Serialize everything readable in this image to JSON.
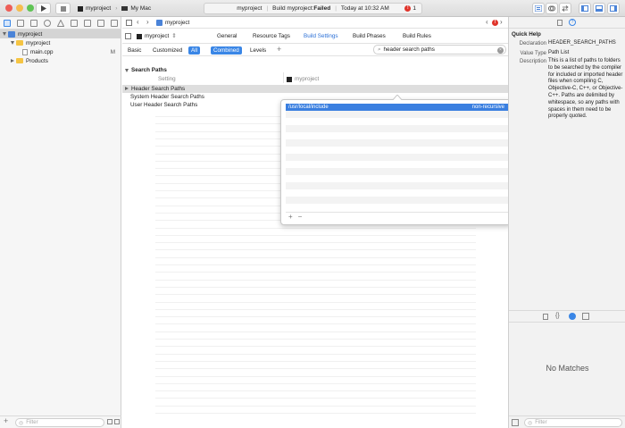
{
  "colors": {
    "accent": "#3a86e6",
    "error": "#e0342b",
    "folder": "#f5c443",
    "close": "#ee5e57",
    "minimize": "#f5bd4f",
    "zoom": "#5fc454"
  },
  "toolbar": {
    "scheme_target": "myproject",
    "scheme_destination": "My Mac",
    "status_project": "myproject",
    "status_message_prefix": "Build myproject: ",
    "status_message_result": "Failed",
    "status_time": "Today at 10:32 AM",
    "error_count": "1",
    "icons": [
      "play-icon",
      "stop-icon",
      "navigator-toggle-icon",
      "debug-toggle-icon",
      "inspector-toggle-icon"
    ]
  },
  "navigator": {
    "items": [
      {
        "label": "myproject",
        "badge": ""
      },
      {
        "label": "myproject",
        "badge": ""
      },
      {
        "label": "main.cpp",
        "badge": "M"
      },
      {
        "label": "Products",
        "badge": ""
      }
    ],
    "filter_placeholder": "Filter"
  },
  "editor": {
    "jump_target": "myproject",
    "error_count": "1",
    "target_selector": "myproject",
    "tabs": [
      "General",
      "Resource Tags",
      "Build Settings",
      "Build Phases",
      "Build Rules"
    ],
    "active_tab": "Build Settings",
    "filters": [
      "Basic",
      "Customized",
      "All",
      "Combined",
      "Levels"
    ],
    "search_value": "header search paths",
    "section_title": "Search Paths",
    "col_setting": "Setting",
    "col_target": "myproject",
    "rows": [
      "Header Search Paths",
      "System Header Search Paths",
      "User Header Search Paths"
    ]
  },
  "popover": {
    "path": "/usr/local/include",
    "mode": "non-recursive",
    "add": "+",
    "remove": "−"
  },
  "inspector": {
    "title": "Quick Help",
    "declaration_label": "Declaration",
    "declaration_value": "HEADER_SEARCH_PATHS",
    "value_type_label": "Value Type",
    "value_type_value": "Path List",
    "description_label": "Description",
    "description_value": "This is a list of paths to folders to be searched by the compiler for included or imported header files when compiling C, Objective-C, C++, or Objective-C++. Paths are delimited by whitespace, so any paths with spaces in them need to be properly quoted.",
    "no_matches": "No Matches",
    "filter_placeholder": "Filter"
  }
}
